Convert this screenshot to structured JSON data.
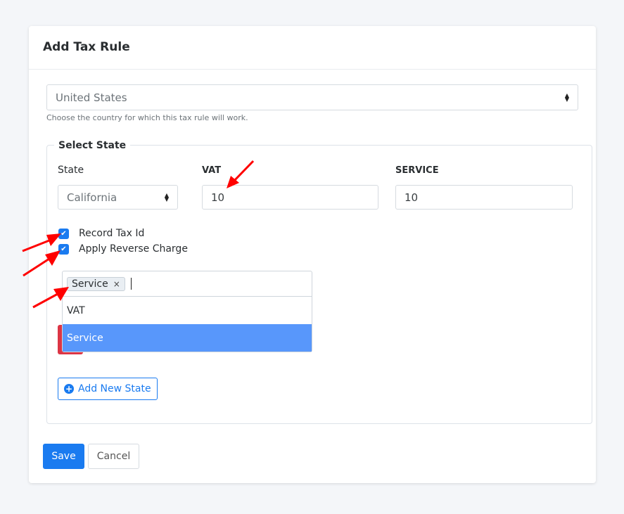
{
  "card": {
    "title": "Add Tax Rule"
  },
  "country": {
    "selected": "United States",
    "help": "Choose the country for which this tax rule will work."
  },
  "state_section": {
    "legend": "Select State",
    "state_label": "State",
    "state_selected": "California",
    "vat_label": "VAT",
    "vat_value": "10",
    "service_label": "SERVICE",
    "service_value": "10"
  },
  "options": {
    "record_tax_id": "Record Tax Id",
    "apply_reverse_charge": "Apply Reverse Charge"
  },
  "multiselect": {
    "selected_tag": "Service",
    "remove_glyph": "×",
    "dropdown_options": [
      "VAT",
      "Service"
    ],
    "highlighted": "Service"
  },
  "buttons": {
    "add_new_state": "Add New State",
    "save": "Save",
    "cancel": "Cancel"
  },
  "colors": {
    "primary": "#1a7bf0",
    "highlight": "#5897fb",
    "danger": "#dc3545",
    "annotation_arrow": "#ff0000"
  }
}
